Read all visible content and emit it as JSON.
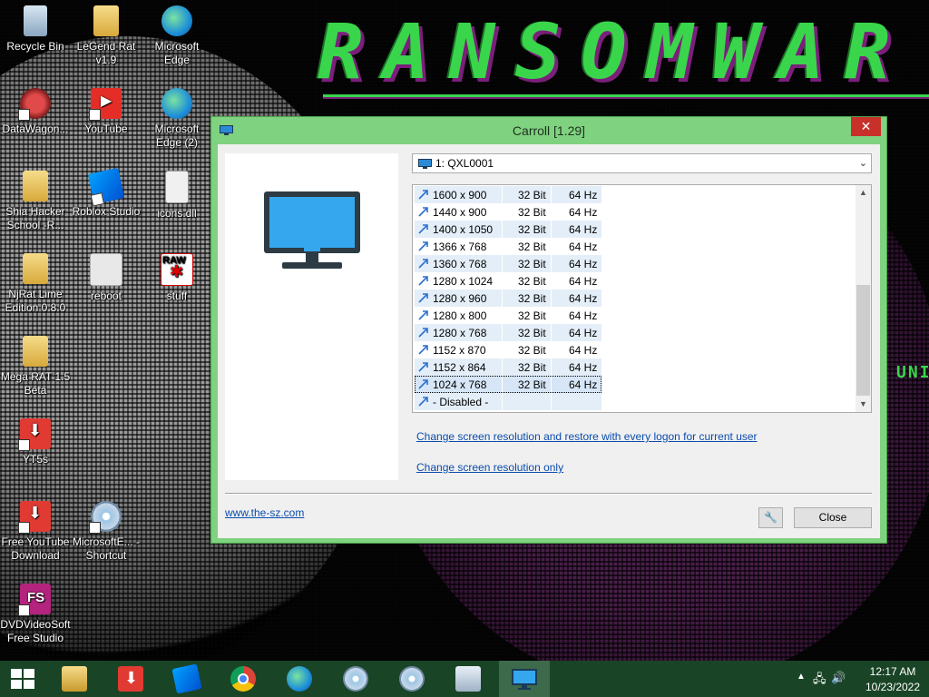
{
  "wallpaper": {
    "title": "RANSOMWAR",
    "side_text": "UNI"
  },
  "desktop_icons": [
    {
      "label": "Recycle Bin",
      "icon": "recycle-bin-icon"
    },
    {
      "label": "LeGend Rat v1.9",
      "icon": "folder-icon"
    },
    {
      "label": "Microsoft Edge",
      "icon": "edge-icon"
    },
    {
      "label": "DataWagon...",
      "icon": "datawagon-icon"
    },
    {
      "label": "YouTube",
      "icon": "youtube-icon"
    },
    {
      "label": "Microsoft Edge (2)",
      "icon": "edge-icon"
    },
    {
      "label": "Shia Hacker School -R...",
      "icon": "folder-icon"
    },
    {
      "label": "Roblox Studio",
      "icon": "roblox-icon"
    },
    {
      "label": "icons.dll",
      "icon": "dll-file-icon"
    },
    {
      "label": "NjRat Lime Edition 0.8.0",
      "icon": "folder-icon"
    },
    {
      "label": "reboot",
      "icon": "reboot-icon"
    },
    {
      "label": "stuff",
      "icon": "raw-icon"
    },
    {
      "label": "Mega RAT 1.5 Beta",
      "icon": "folder-icon"
    },
    {
      "label": "YT5s",
      "icon": "yt5s-icon"
    },
    {
      "label": "Free YouTube Download",
      "icon": "download-icon"
    },
    {
      "label": "MicrosoftE... - Shortcut",
      "icon": "disc-icon"
    },
    {
      "label": "DVDVideoSoft Free Studio",
      "icon": "dvdvideosoft-icon"
    }
  ],
  "window": {
    "title": "Carroll [1.29]",
    "close_glyph": "✕",
    "display": {
      "selected": "1: QXL0001",
      "arrow": "⌄"
    },
    "resolutions": [
      {
        "res": "1600 x 900",
        "depth": "32 Bit",
        "freq": "64 Hz"
      },
      {
        "res": "1440 x 900",
        "depth": "32 Bit",
        "freq": "64 Hz"
      },
      {
        "res": "1400 x 1050",
        "depth": "32 Bit",
        "freq": "64 Hz"
      },
      {
        "res": "1366 x 768",
        "depth": "32 Bit",
        "freq": "64 Hz"
      },
      {
        "res": "1360 x 768",
        "depth": "32 Bit",
        "freq": "64 Hz"
      },
      {
        "res": "1280 x 1024",
        "depth": "32 Bit",
        "freq": "64 Hz"
      },
      {
        "res": "1280 x 960",
        "depth": "32 Bit",
        "freq": "64 Hz"
      },
      {
        "res": "1280 x 800",
        "depth": "32 Bit",
        "freq": "64 Hz"
      },
      {
        "res": "1280 x 768",
        "depth": "32 Bit",
        "freq": "64 Hz"
      },
      {
        "res": "1152 x 870",
        "depth": "32 Bit",
        "freq": "64 Hz"
      },
      {
        "res": "1152 x 864",
        "depth": "32 Bit",
        "freq": "64 Hz"
      },
      {
        "res": "1024 x 768",
        "depth": "32 Bit",
        "freq": "64 Hz"
      },
      {
        "res": "- Disabled -",
        "depth": "",
        "freq": ""
      }
    ],
    "selected_resolution": "1024 x 768",
    "link_restore": "Change screen resolution and restore with every logon for current user",
    "link_only": "Change screen resolution only",
    "link_site": "www.the-sz.com",
    "tool_button_glyph": "🔧",
    "close_button": "Close",
    "scroll_up_glyph": "▲",
    "scroll_down_glyph": "▼"
  },
  "taskbar": {
    "apps": [
      "start",
      "file-explorer",
      "free-youtube-download",
      "roblox-studio",
      "chrome",
      "edge",
      "app-disc-1",
      "app-disc-2",
      "task-monitor",
      "carroll"
    ],
    "tray": {
      "up_glyph": "▲",
      "network_glyph": "🖧",
      "volume_glyph": "🔊",
      "time": "12:17 AM",
      "date": "10/23/2022"
    }
  },
  "colors": {
    "window_frame": "#7fd27f",
    "wallpaper_green": "#39d64b",
    "wallpaper_purple": "#7a1f7a",
    "taskbar": "#1a4426",
    "link": "#0b4cad",
    "close_red": "#c7312a"
  }
}
